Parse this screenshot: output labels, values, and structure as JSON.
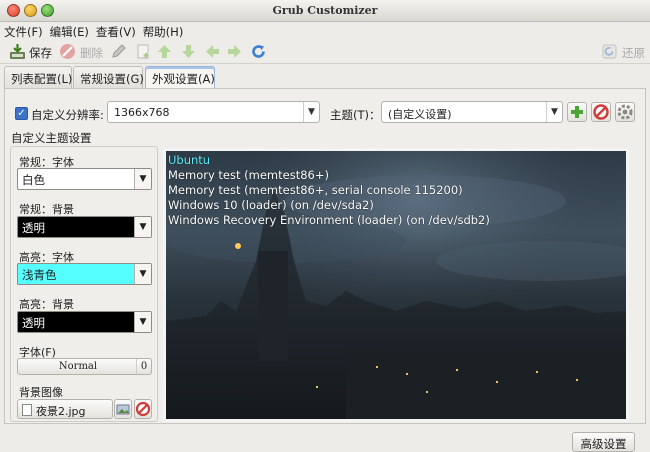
{
  "window": {
    "title": "Grub Customizer"
  },
  "menu": [
    "文件(F)",
    "编辑(E)",
    "查看(V)",
    "帮助(H)"
  ],
  "toolbar": {
    "save": "保存",
    "delete": "删除",
    "revert": "还原"
  },
  "tabs": [
    "列表配置(L)",
    "常规设置(G)",
    "外观设置(A)"
  ],
  "resolution": {
    "label": "自定义分辨率:",
    "value": "1366x768"
  },
  "theme": {
    "label": "主题(T)：",
    "value": "(自定义设置)"
  },
  "custom_group": {
    "title": "自定义主题设置",
    "normal_font": {
      "label": "常规：字体",
      "value": "白色",
      "swatch": "#ffffff"
    },
    "normal_bg": {
      "label": "常规：背景",
      "value": "透明",
      "swatch": "#000000"
    },
    "highlight_font": {
      "label": "高亮：字体",
      "value": "浅青色",
      "swatch": "#55ffff"
    },
    "highlight_bg": {
      "label": "高亮：背景",
      "value": "透明",
      "swatch": "#000000"
    },
    "font": {
      "label": "字体(F)",
      "name": "Normal",
      "size": "0"
    },
    "bg_image": {
      "label": "背景图像",
      "file": "夜景2.jpg"
    }
  },
  "preview": {
    "entries": [
      "Ubuntu",
      "Memory test (memtest86+)",
      "Memory test (memtest86+, serial console 115200)",
      "Windows 10 (loader) (on /dev/sda2)",
      "Windows Recovery Environment (loader) (on /dev/sdb2)"
    ]
  },
  "advanced_button": "高级设置"
}
